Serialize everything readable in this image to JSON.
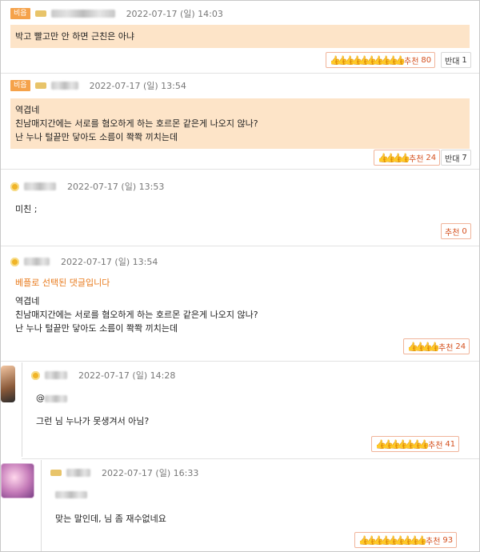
{
  "comments": [
    {
      "badge": "비읍",
      "datetime": "2022-07-17 (일) 14:03",
      "lines": [
        "박고 빨고만 안 하면 근친은 아냐"
      ],
      "up_label": "추천",
      "up_count": "80",
      "down_label": "반대",
      "down_count": "1"
    },
    {
      "badge": "비읍",
      "datetime": "2022-07-17 (일) 13:54",
      "lines": [
        "역겹네",
        "친남매지간에는 서로를 혐오하게 하는 호르몬 같은게 나오지 않나?",
        "난 누나 털끝만 닿아도 소름이 쫙쫙 끼치는데"
      ],
      "up_label": "추천",
      "up_count": "24",
      "down_label": "반대",
      "down_count": "7"
    },
    {
      "datetime": "2022-07-17 (일) 13:53",
      "lines": [
        "미친 ;"
      ],
      "up_label": "추천",
      "up_count": "0"
    },
    {
      "datetime": "2022-07-17 (일) 13:54",
      "best_label": "베플로 선택된 댓글입니다",
      "lines": [
        "역겹네",
        "친남매지간에는 서로를 혐오하게 하는 호르몬 같은게 나오지 않나?",
        "난 누나 털끝만 닿아도 소름이 쫙쫙 끼치는데"
      ],
      "up_label": "추천",
      "up_count": "24"
    },
    {
      "datetime": "2022-07-17 (일) 14:28",
      "mention": "@",
      "lines": [
        "그런 님 누나가 못생겨서 아님?"
      ],
      "up_label": "추천",
      "up_count": "41"
    },
    {
      "datetime": "2022-07-17 (일) 16:33",
      "lines": [
        "맞는 말인데, 님 좀 재수없네요"
      ],
      "up_label": "추천",
      "up_count": "93"
    }
  ],
  "colors": {
    "highlight_bg": "#fde4c8",
    "badge_bg": "#f5a24a",
    "best_text": "#e87a1c",
    "vote_text": "#d4501e"
  },
  "icons": {
    "vote_icon": "thumbs-up-icon",
    "level_icon": "sun-level-icon"
  }
}
